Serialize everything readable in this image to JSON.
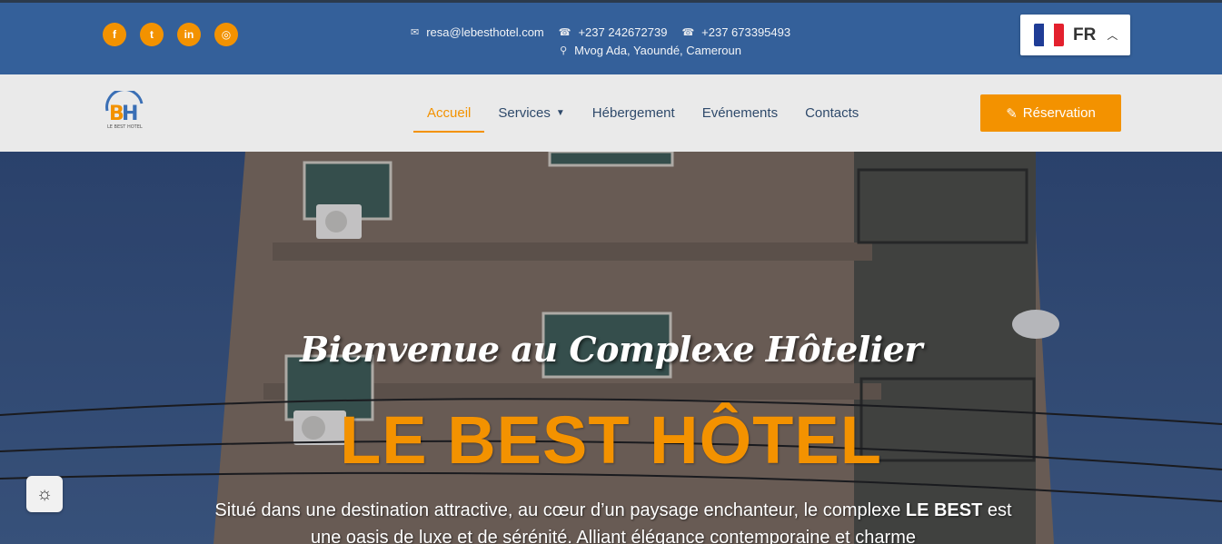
{
  "topbar": {
    "social": [
      {
        "icon": "facebook-icon",
        "glyph": "f"
      },
      {
        "icon": "twitter-icon",
        "glyph": "t"
      },
      {
        "icon": "linkedin-icon",
        "glyph": "in"
      },
      {
        "icon": "instagram-icon",
        "glyph": "◎"
      }
    ],
    "email": "resa@lebesthotel.com",
    "phone1": "+237 242672739",
    "phone2": "+237 673395493",
    "address": "Mvog Ada, Yaoundé, Cameroun",
    "language": {
      "code": "FR",
      "flag_colors": [
        "#1f3c96",
        "#ffffff",
        "#e3202d"
      ]
    }
  },
  "nav": {
    "logo_text": "LE BEST HOTEL",
    "items": [
      {
        "label": "Accueil",
        "active": true
      },
      {
        "label": "Services",
        "has_dropdown": true
      },
      {
        "label": "Hébergement"
      },
      {
        "label": "Evénements"
      },
      {
        "label": "Contacts"
      }
    ],
    "reservation_label": "Réservation"
  },
  "hero": {
    "welcome": "Bienvenue au Complexe Hôtelier",
    "hotel_name": "LE BEST HÔTEL",
    "desc_part1": "Situé dans une destination attractive, au cœur d’un paysage enchanteur, le complexe ",
    "desc_bold": "LE BEST",
    "desc_part2": " est une oasis de luxe et de sérénité. Alliant élégance contemporaine et charme"
  },
  "colors": {
    "accent": "#f39200",
    "topbar": "#34609a",
    "nav_bg": "#eaeaea",
    "nav_text": "#2f4a6b"
  }
}
